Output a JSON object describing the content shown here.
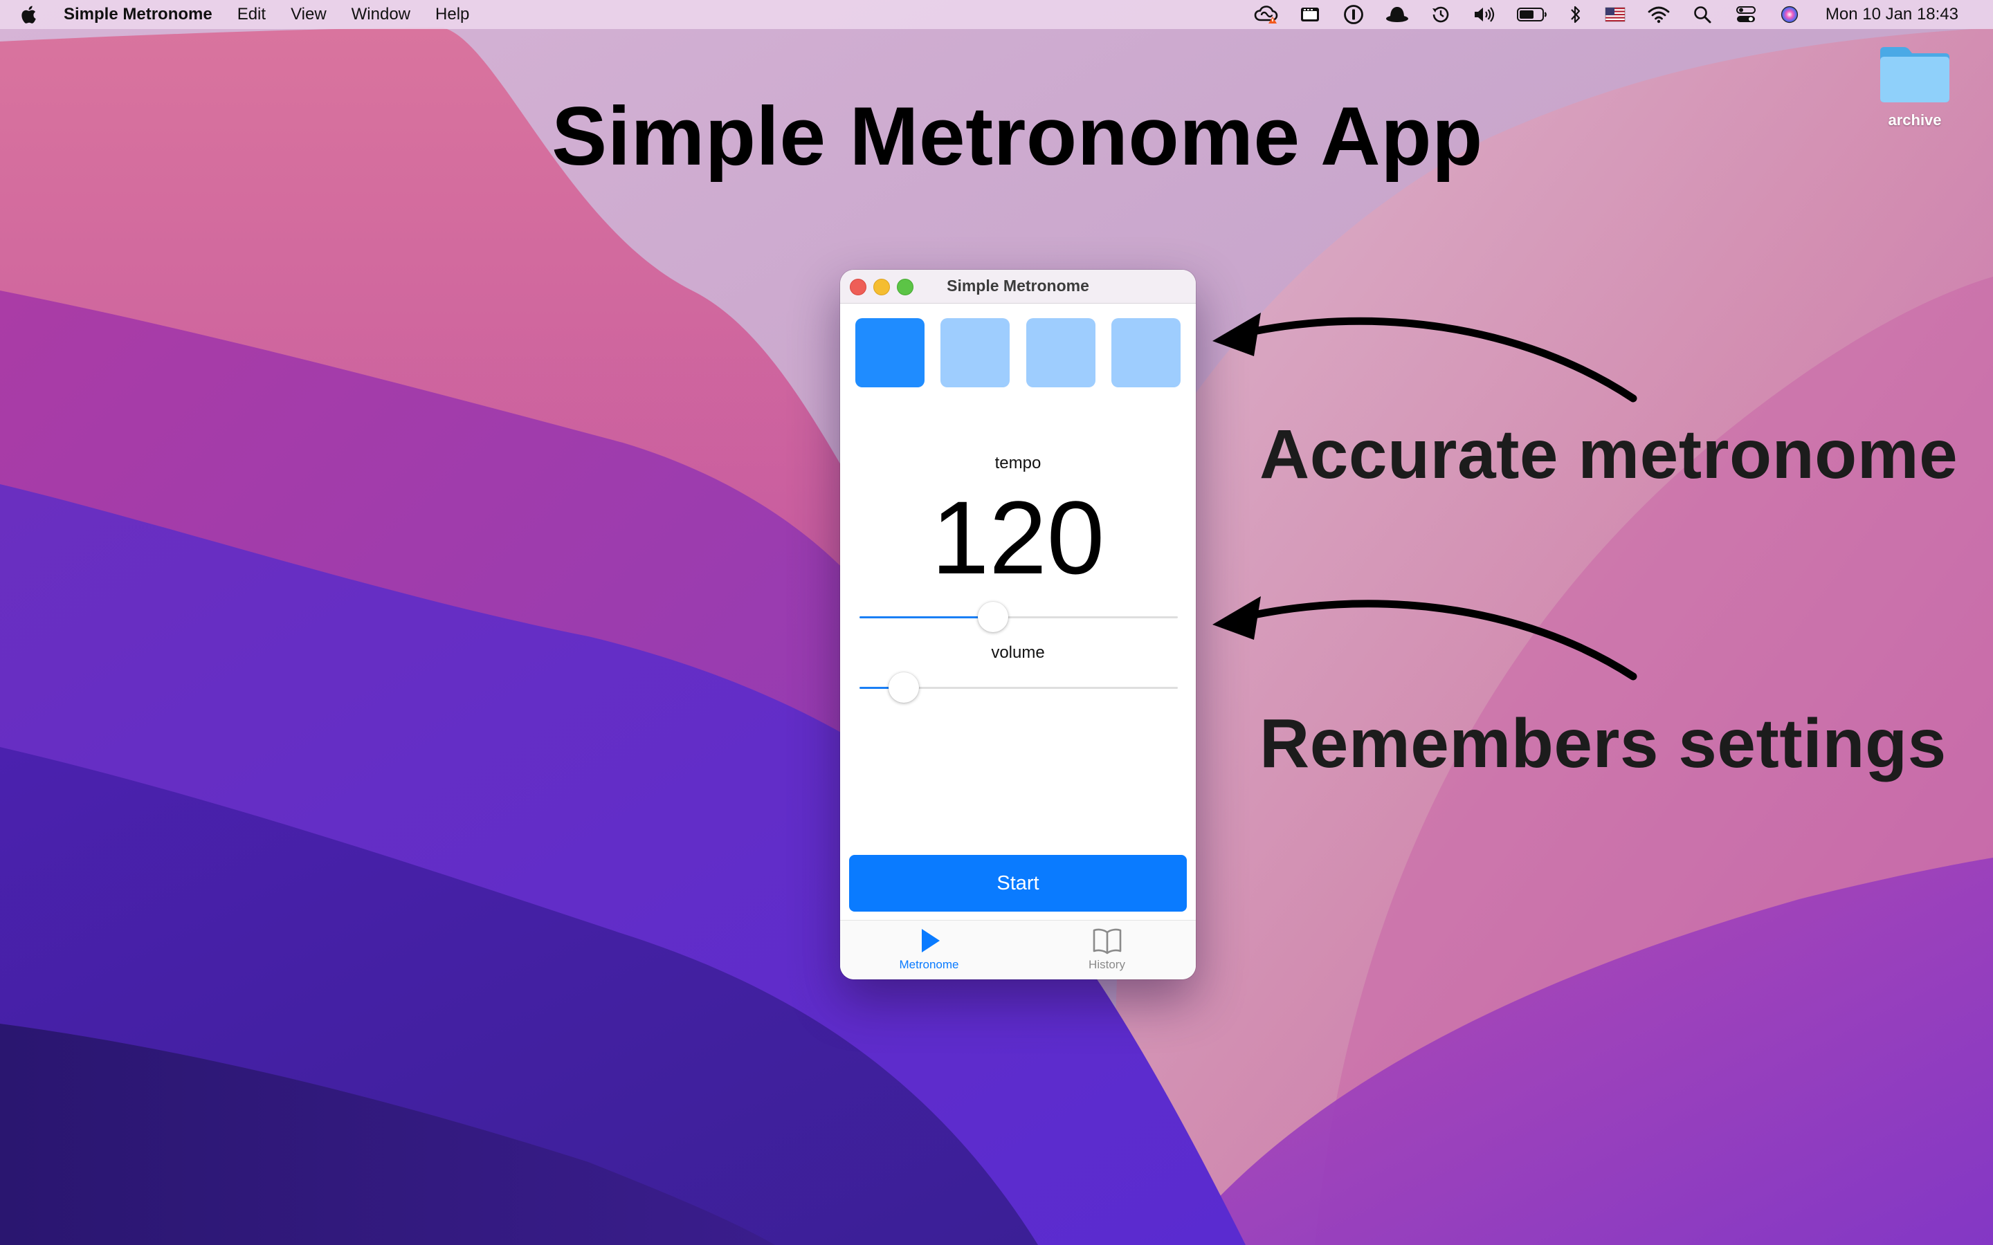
{
  "menubar": {
    "app_name": "Simple Metronome",
    "menus": [
      "Edit",
      "View",
      "Window",
      "Help"
    ],
    "status_icons": [
      "creative-cloud-icon",
      "clipboard-icon",
      "password-manager-icon",
      "bowler-hat-icon",
      "time-machine-icon",
      "volume-icon",
      "battery-icon",
      "bluetooth-icon",
      "flag-us-icon",
      "wifi-icon",
      "search-icon",
      "control-center-icon",
      "siri-icon"
    ],
    "clock": "Mon 10 Jan  18:43"
  },
  "headline": "Simple Metronome App",
  "annotations": {
    "accurate": "Accurate metronome",
    "remembers": "Remembers settings"
  },
  "desktop": {
    "folder_label": "archive"
  },
  "window": {
    "title": "Simple Metronome",
    "beats": {
      "count": 4,
      "active_index": 0
    },
    "tempo": {
      "label": "tempo",
      "value": "120",
      "slider_fraction": 0.42
    },
    "volume": {
      "label": "volume",
      "slider_fraction": 0.14
    },
    "start_label": "Start",
    "tabs": [
      {
        "label": "Metronome",
        "icon": "play-icon",
        "selected": true
      },
      {
        "label": "History",
        "icon": "book-icon",
        "selected": false
      }
    ]
  },
  "colors": {
    "accent": "#0a7bff",
    "beat_active": "#1f8cff",
    "beat_inactive": "#9ecdfe"
  }
}
